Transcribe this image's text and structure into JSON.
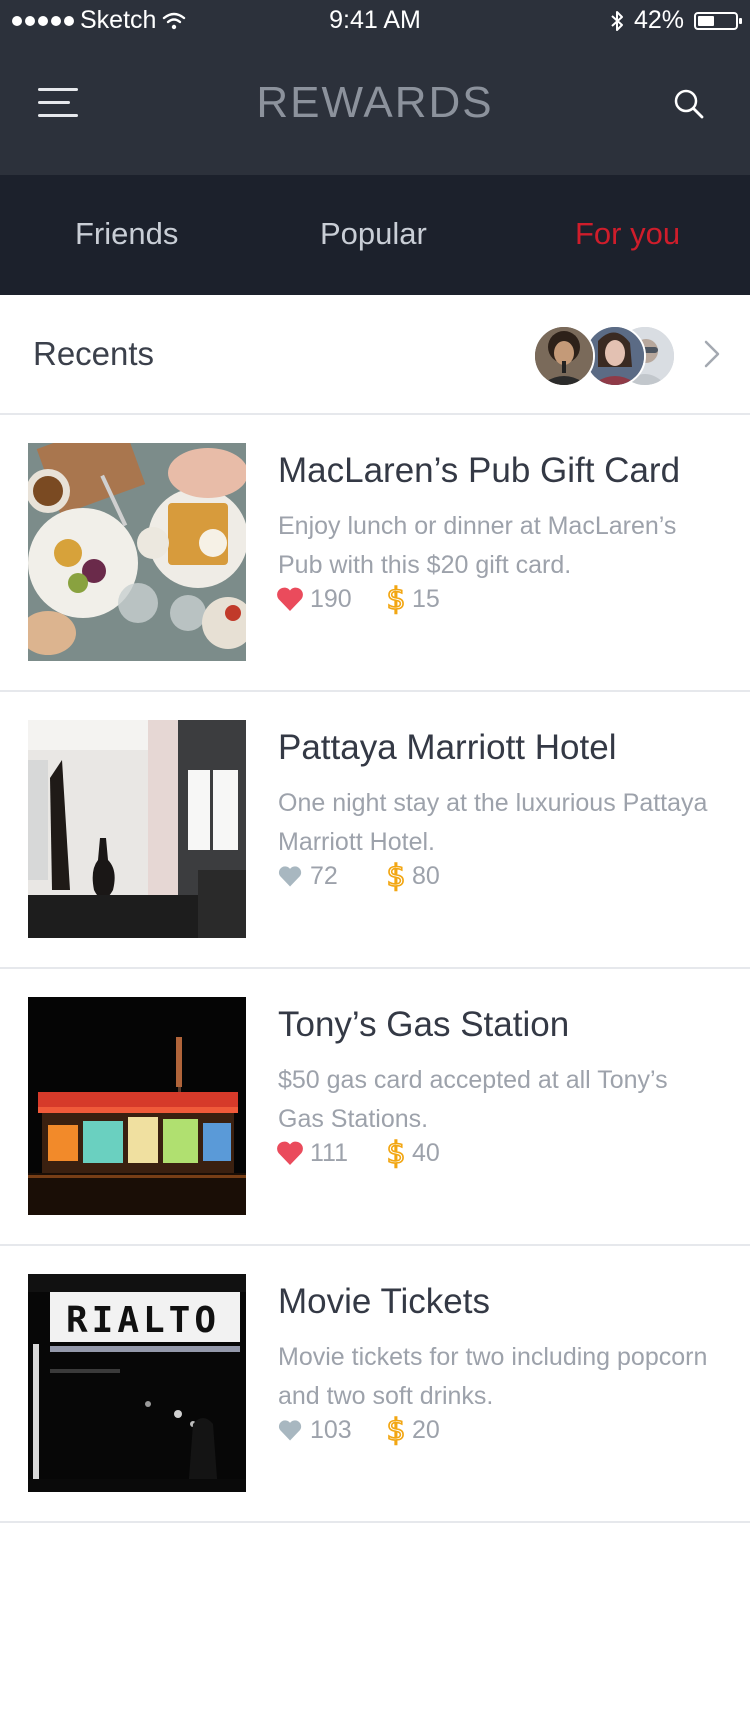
{
  "status_bar": {
    "carrier": "Sketch",
    "time": "9:41 AM",
    "battery": "42%"
  },
  "header": {
    "title": "REWARDS",
    "menu_icon": "hamburger-menu-icon",
    "search_icon": "search-icon"
  },
  "tabs": [
    {
      "label": "Friends",
      "active": false
    },
    {
      "label": "Popular",
      "active": false
    },
    {
      "label": "For you",
      "active": true
    }
  ],
  "recents": {
    "label": "Recents",
    "avatars": [
      "avatar-1",
      "avatar-2",
      "avatar-3"
    ]
  },
  "colors": {
    "header_bg": "#2c313b",
    "tabs_bg": "#1c212c",
    "accent_red": "#cf1d2b",
    "heart_liked": "#ea4b5c",
    "heart_default": "#a8b7c0",
    "coin": "#f2a612"
  },
  "rewards": [
    {
      "name": "MacLaren’s Pub Gift Card",
      "description": "Enjoy lunch or dinner at MacLaren’s Pub with this $20 gift card.",
      "likes": "190",
      "liked": true,
      "price": "15"
    },
    {
      "name": "Pattaya Marriott Hotel",
      "description": "One night stay at the luxurious Pattaya Marriott Hotel.",
      "likes": "72",
      "liked": false,
      "price": "80"
    },
    {
      "name": "Tony’s Gas Station",
      "description": "$50 gas card accepted at all Tony’s Gas Stations.",
      "likes": "111",
      "liked": true,
      "price": "40"
    },
    {
      "name": "Movie Tickets",
      "description": "Movie tickets for two including popcorn and two soft drinks.",
      "likes": "103",
      "liked": false,
      "price": "20",
      "sign_text": "RIALTO"
    }
  ]
}
